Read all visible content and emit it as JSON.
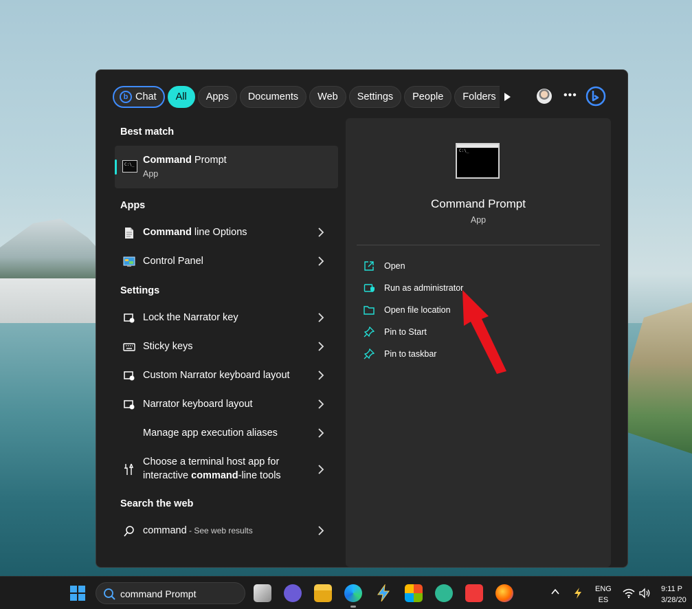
{
  "filters": {
    "chat": "Chat",
    "all": "All",
    "apps": "Apps",
    "documents": "Documents",
    "web": "Web",
    "settings": "Settings",
    "people": "People",
    "folders": "Folders"
  },
  "best_match": {
    "heading": "Best match",
    "title_bold": "Command",
    "title_rest": " Prompt",
    "subtitle": "App"
  },
  "apps": {
    "heading": "Apps",
    "items": [
      {
        "bold": "Command",
        "rest": " line Options"
      },
      {
        "label": "Control Panel"
      }
    ]
  },
  "settings": {
    "heading": "Settings",
    "items": [
      {
        "label": "Lock the Narrator key"
      },
      {
        "label": "Sticky keys"
      },
      {
        "label": "Custom Narrator keyboard layout"
      },
      {
        "label": "Narrator keyboard layout"
      },
      {
        "label": "Manage app execution aliases"
      },
      {
        "pre": "Choose a terminal host app for interactive ",
        "bold": "command",
        "post": "-line tools"
      }
    ]
  },
  "web": {
    "heading": "Search the web",
    "query": "command",
    "suffix": " - See web results"
  },
  "details": {
    "title": "Command Prompt",
    "subtitle": "App",
    "actions": [
      "Open",
      "Run as administrator",
      "Open file location",
      "Pin to Start",
      "Pin to taskbar"
    ]
  },
  "taskbar": {
    "search_text": "command Prompt",
    "lang_line1": "ENG",
    "lang_line2": "ES",
    "time": "9:11 P",
    "date": "3/28/20"
  },
  "colors": {
    "accent": "#22e0d8",
    "panel": "#202020",
    "arrow": "#e8141c"
  }
}
